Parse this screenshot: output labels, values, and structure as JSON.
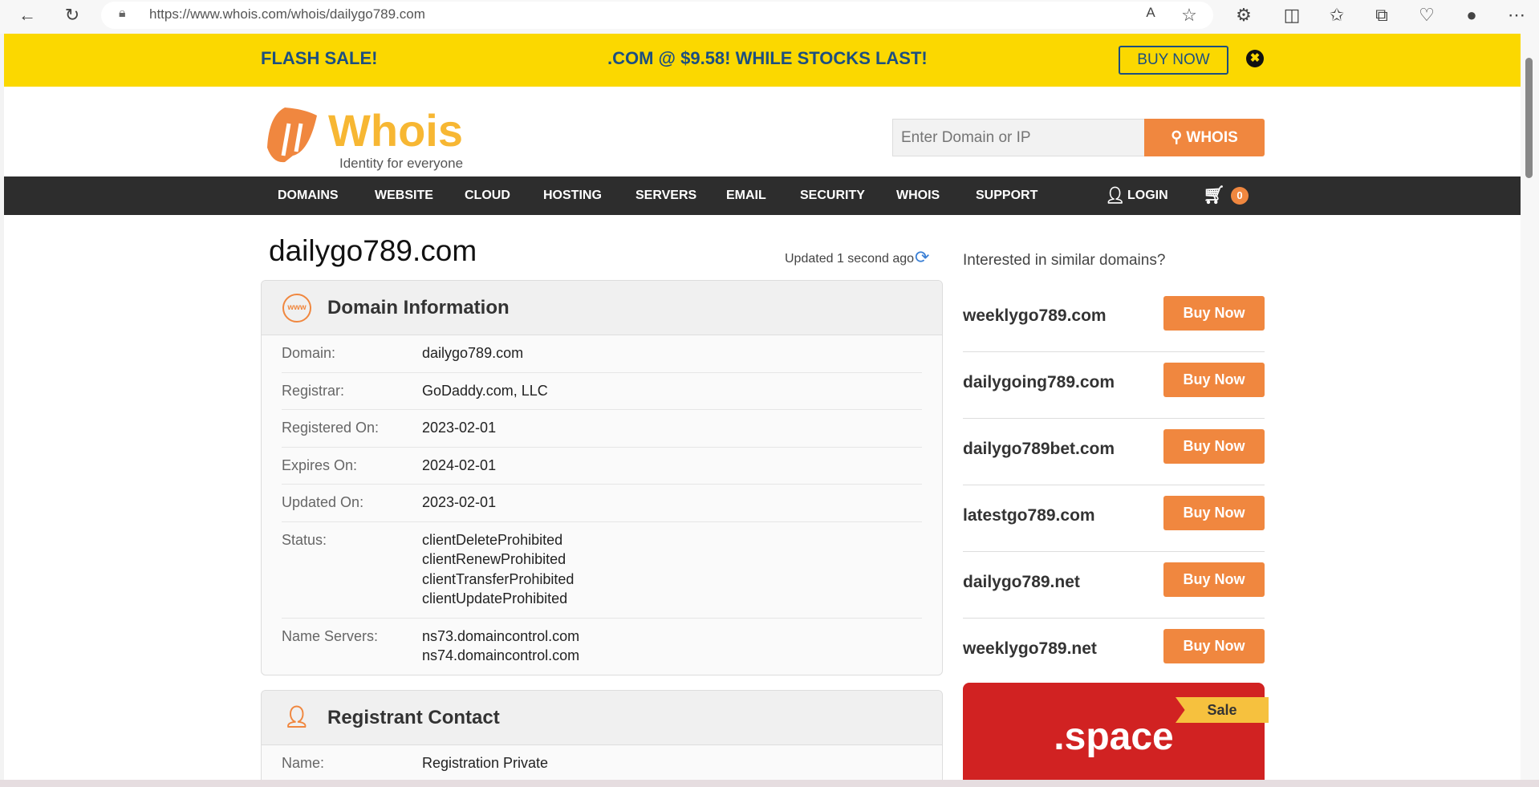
{
  "browser": {
    "url": "https://www.whois.com/whois/dailygo789.com"
  },
  "banner": {
    "flash": "FLASH SALE!",
    "offer": ".COM @ $9.58! WHILE STOCKS LAST!",
    "buy": "BUY NOW",
    "close": "✖"
  },
  "header": {
    "logo_text": "Whois",
    "logo_tagline": "Identity for everyone",
    "search_placeholder": "Enter Domain or IP",
    "search_button": "WHOIS"
  },
  "nav": {
    "items": [
      "DOMAINS",
      "WEBSITE",
      "CLOUD",
      "HOSTING",
      "SERVERS",
      "EMAIL",
      "SECURITY",
      "WHOIS",
      "SUPPORT"
    ],
    "login": "LOGIN",
    "cart_count": "0"
  },
  "main": {
    "title": "dailygo789.com",
    "updated": "Updated 1 second ago",
    "domain_info": {
      "heading": "Domain Information",
      "icon_text": "www",
      "rows": [
        {
          "label": "Domain:",
          "value": "dailygo789.com"
        },
        {
          "label": "Registrar:",
          "value": "GoDaddy.com, LLC"
        },
        {
          "label": "Registered On:",
          "value": "2023-02-01"
        },
        {
          "label": "Expires On:",
          "value": "2024-02-01"
        },
        {
          "label": "Updated On:",
          "value": "2023-02-01"
        },
        {
          "label": "Status:",
          "value": "clientDeleteProhibited\nclientRenewProhibited\nclientTransferProhibited\nclientUpdateProhibited"
        },
        {
          "label": "Name Servers:",
          "value": "ns73.domaincontrol.com\nns74.domaincontrol.com"
        }
      ]
    },
    "registrant": {
      "heading": "Registrant Contact",
      "rows": [
        {
          "label": "Name:",
          "value": "Registration Private"
        }
      ]
    }
  },
  "sidebar": {
    "heading": "Interested in similar domains?",
    "button": "Buy Now",
    "domains": [
      "weeklygo789.com",
      "dailygoing789.com",
      "dailygo789bet.com",
      "latestgo789.com",
      "dailygo789.net",
      "weeklygo789.net"
    ],
    "ad": {
      "tld": ".space",
      "badge": "Sale"
    }
  },
  "colors": {
    "accent": "#f0873f",
    "banner": "#fbd800",
    "nav": "#2d2d2d",
    "ad": "#d12222"
  }
}
